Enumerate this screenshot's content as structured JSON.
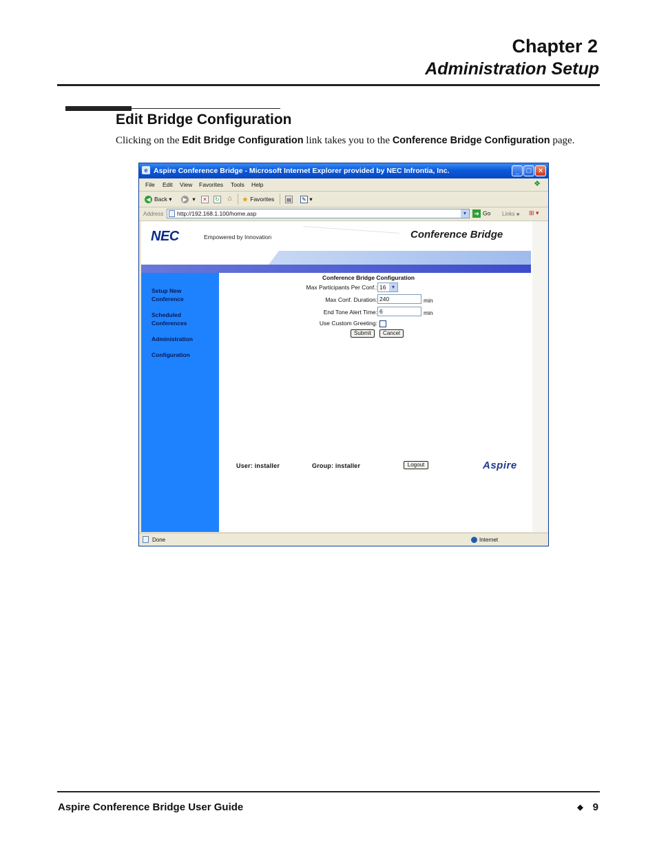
{
  "header": {
    "chapter_number": "Chapter 2",
    "chapter_title": "Administration Setup"
  },
  "section": {
    "title": "Edit Bridge Configuration",
    "intro_pre": "Clicking on the ",
    "intro_bold1": "Edit Bridge Configuration",
    "intro_mid": " link takes you to the ",
    "intro_bold2": "Conference Bridge Configuration",
    "intro_post": " page."
  },
  "browser": {
    "title": "Aspire Conference Bridge - Microsoft Internet Explorer provided by NEC Infrontia, Inc.",
    "menu": [
      "File",
      "Edit",
      "View",
      "Favorites",
      "Tools",
      "Help"
    ],
    "toolbar": {
      "back": "Back",
      "favorites": "Favorites"
    },
    "address_label": "Address",
    "address_url": "http://192.168.1.100/home.asp",
    "go_label": "Go",
    "links_label": "Links",
    "status_text": "Done",
    "zone_text": "Internet"
  },
  "app": {
    "logo": "NEC",
    "tagline": "Empowered by Innovation",
    "product_title": "Conference Bridge",
    "sidebar": [
      {
        "line1": "Setup New",
        "line2": "Conference"
      },
      {
        "line1": "Scheduled",
        "line2": "Conferences"
      },
      {
        "line1": "Administration",
        "line2": ""
      },
      {
        "line1": "Configuration",
        "line2": ""
      }
    ],
    "form": {
      "title": "Conference Bridge Configuration",
      "max_participants_label": "Max Participants Per Conf.:",
      "max_participants_value": "16",
      "max_duration_label": "Max Conf. Duration:",
      "max_duration_value": "240",
      "end_tone_label": "End Tone Alert Time:",
      "end_tone_value": "6",
      "unit": "min",
      "custom_greeting_label": "Use Custom Greeting:",
      "custom_greeting_checked": false,
      "submit_label": "Submit",
      "cancel_label": "Cancel"
    },
    "footer": {
      "user_label": "User: installer",
      "group_label": "Group: installer",
      "logout_label": "Logout",
      "brand": "Aspire"
    }
  },
  "page_footer": {
    "left": "Aspire Conference Bridge User Guide",
    "page_number": "9"
  },
  "colors": {
    "sidebar": "#1e82ff",
    "title_bar": "#0b5ad9",
    "band": "#a9c2ee"
  }
}
